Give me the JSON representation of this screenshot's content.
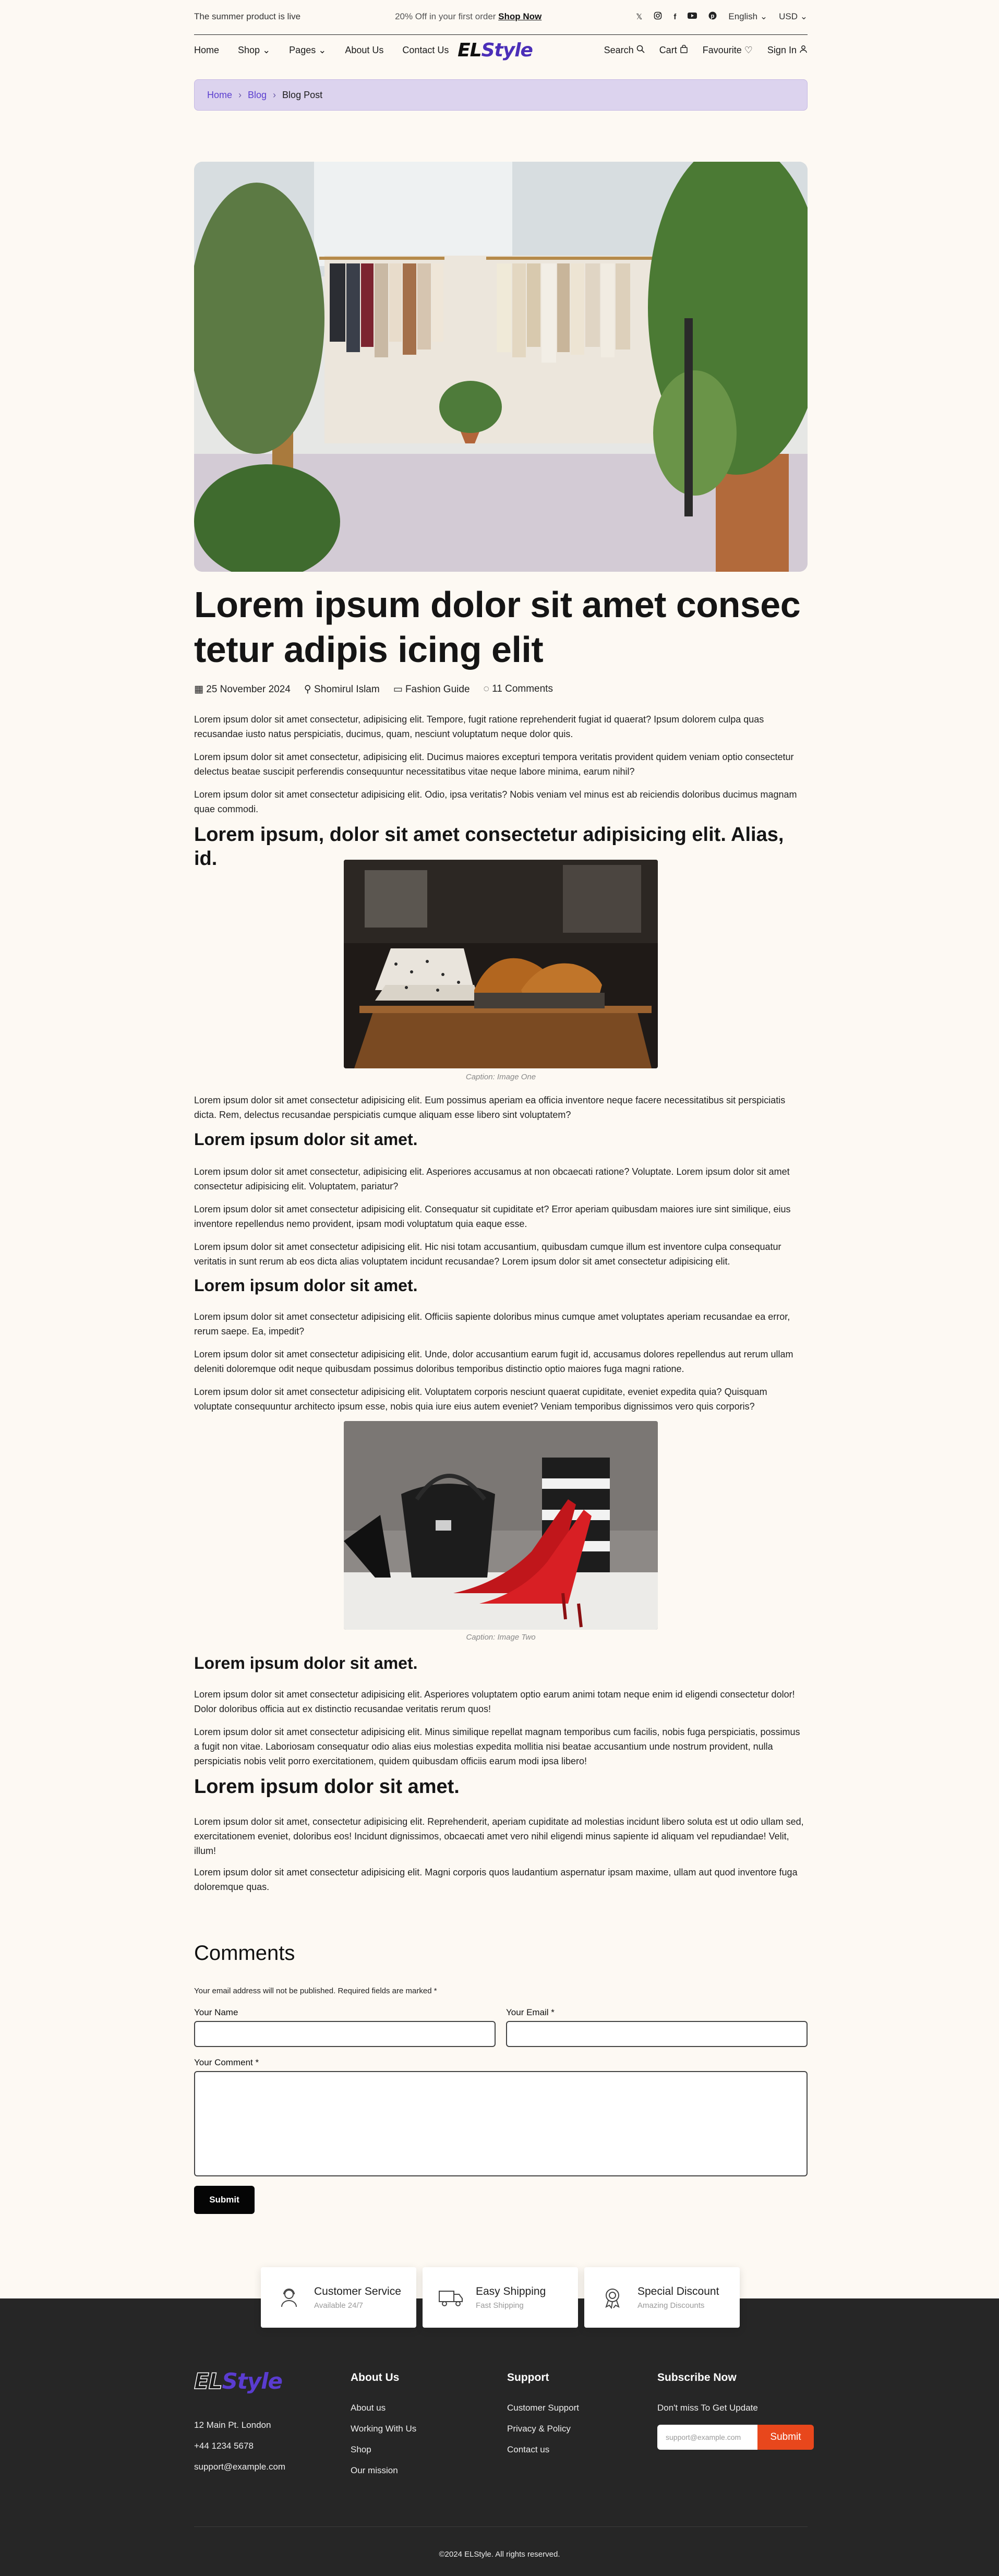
{
  "topbar": {
    "left_text": "The summer product is live",
    "promo_text": "20% Off in your first order",
    "promo_link": "Shop Now",
    "language": "English",
    "currency": "USD"
  },
  "nav": {
    "items": [
      "Home",
      "Shop",
      "Pages",
      "About Us",
      "Contact Us"
    ],
    "logo_part1": "EL",
    "logo_part2": "Style",
    "search": "Search",
    "cart": "Cart",
    "favourite": "Favourite",
    "signin": "Sign In"
  },
  "breadcrumb": [
    "Home",
    "Blog",
    "Blog Post"
  ],
  "post": {
    "title": "Lorem ipsum dolor sit amet consec tetur adipis icing elit",
    "date": "25 November 2024",
    "author": "Shomirul Islam",
    "category": "Fashion Guide",
    "comments": "11 Comments",
    "intro": [
      "Lorem ipsum dolor sit amet consectetur, adipisicing elit. Tempore, fugit ratione reprehenderit fugiat id quaerat? Ipsum dolorem culpa quas recusandae iusto natus perspiciatis, ducimus, quam, nesciunt voluptatum neque dolor quis.",
      "Lorem ipsum dolor sit amet consectetur, adipisicing elit. Ducimus maiores excepturi tempora veritatis provident quidem veniam optio consectetur delectus beatae suscipit perferendis consequuntur necessitatibus vitae neque labore minima, earum nihil?",
      "Lorem ipsum dolor sit amet consectetur adipisicing elit. Odio, ipsa veritatis? Nobis veniam vel minus est ab reiciendis doloribus ducimus magnam quae commodi."
    ],
    "h2": "Lorem ipsum, dolor sit amet consectetur adipisicing elit. Alias, id.",
    "caption1": "Caption: Image One",
    "after_fig1": "Lorem ipsum dolor sit amet consectetur adipisicing elit. Eum possimus aperiam ea officia inventore neque facere necessitatibus sit perspiciatis dicta. Rem, delectus recusandae perspiciatis cumque aliquam esse libero sint voluptatem?",
    "h3a": "Lorem ipsum dolor sit amet.",
    "sec_a": [
      "Lorem ipsum dolor sit amet consectetur, adipisicing elit. Asperiores accusamus at non obcaecati ratione? Voluptate. Lorem ipsum dolor sit amet consectetur adipisicing elit. Voluptatem, pariatur?",
      "Lorem ipsum dolor sit amet consectetur adipisicing elit. Consequatur sit cupiditate et? Error aperiam quibusdam maiores iure sint similique, eius inventore repellendus nemo provident, ipsam modi voluptatum quia eaque esse.",
      "Lorem ipsum dolor sit amet consectetur adipisicing elit. Hic nisi totam accusantium, quibusdam cumque illum est inventore culpa consequatur veritatis in sunt rerum ab eos dicta alias voluptatem incidunt recusandae? Lorem ipsum dolor sit amet consectetur adipisicing elit."
    ],
    "h3b": "Lorem ipsum dolor sit amet.",
    "sec_b": [
      "Lorem ipsum dolor sit amet consectetur adipisicing elit. Officiis sapiente doloribus minus cumque amet voluptates aperiam recusandae ea error, rerum saepe. Ea, impedit?",
      "Lorem ipsum dolor sit amet consectetur adipisicing elit. Unde, dolor accusantium earum fugit id, accusamus dolores repellendus aut rerum ullam deleniti doloremque odit neque quibusdam possimus doloribus temporibus distinctio optio maiores fuga magni ratione.",
      "Lorem ipsum dolor sit amet consectetur adipisicing elit. Voluptatem corporis nesciunt quaerat cupiditate, eveniet expedita quia? Quisquam voluptate consequuntur architecto ipsum esse, nobis quia iure eius autem eveniet? Veniam temporibus dignissimos vero quis corporis?"
    ],
    "caption2": "Caption: Image Two",
    "h3c": "Lorem ipsum dolor sit amet.",
    "sec_c": [
      "Lorem ipsum dolor sit amet consectetur adipisicing elit. Asperiores voluptatem optio earum animi totam neque enim id eligendi consectetur dolor! Dolor doloribus officia aut ex distinctio recusandae veritatis rerum quos!",
      "Lorem ipsum dolor sit amet consectetur adipisicing elit. Minus similique repellat magnam temporibus cum facilis, nobis fuga perspiciatis, possimus a fugit non vitae. Laboriosam consequatur odio alias eius molestias expedita mollitia nisi beatae accusantium unde nostrum provident, nulla perspiciatis nobis velit porro exercitationem, quidem quibusdam officiis earum modi ipsa libero!"
    ],
    "h2b": "Lorem ipsum dolor sit amet.",
    "sec_d": [
      "Lorem ipsum dolor sit amet, consectetur adipisicing elit. Reprehenderit, aperiam cupiditate ad molestias incidunt libero soluta est ut odio ullam sed, exercitationem eveniet, doloribus eos! Incidunt dignissimos, obcaecati amet vero nihil eligendi minus sapiente id aliquam vel repudiandae! Velit, illum!",
      "Lorem ipsum dolor sit amet consectetur adipisicing elit. Magni corporis quos laudantium aspernatur ipsam maxime, ullam aut quod inventore fuga doloremque quas."
    ]
  },
  "comments": {
    "title": "Comments",
    "note": "Your email address will not be published. Required fields are marked *",
    "name_label": "Your Name",
    "email_label": "Your Email *",
    "comment_label": "Your Comment *",
    "submit": "Submit"
  },
  "features": [
    {
      "title": "Customer Service",
      "sub": "Available 24/7",
      "icon": "support-agent-icon"
    },
    {
      "title": "Easy Shipping",
      "sub": "Fast Shipping",
      "icon": "truck-icon"
    },
    {
      "title": "Special Discount",
      "sub": "Amazing Discounts",
      "icon": "discount-badge-icon"
    }
  ],
  "footer": {
    "logo_part1": "EL",
    "logo_part2": "Style",
    "address": "12 Main Pt. London",
    "phone": "+44 1234 5678",
    "email": "support@example.com",
    "about_title": "About Us",
    "about_links": [
      "About us",
      "Working With Us",
      "Shop",
      "Our mission"
    ],
    "support_title": "Support",
    "support_links": [
      "Customer Support",
      "Privacy & Policy",
      "Contact us"
    ],
    "subscribe_title": "Subscribe Now",
    "subscribe_text": "Don't miss To Get Update",
    "subscribe_placeholder": "support@example.com",
    "subscribe_button": "Submit",
    "copyright": "©2024 ELStyle. All rights reserved."
  },
  "colors": {
    "accent": "#4b2fb8",
    "breadcrumb_bg": "#dcd3ee",
    "footer_bg": "#262626",
    "subscribe_btn": "#e8471c",
    "page_bg": "#fdf9f3"
  }
}
